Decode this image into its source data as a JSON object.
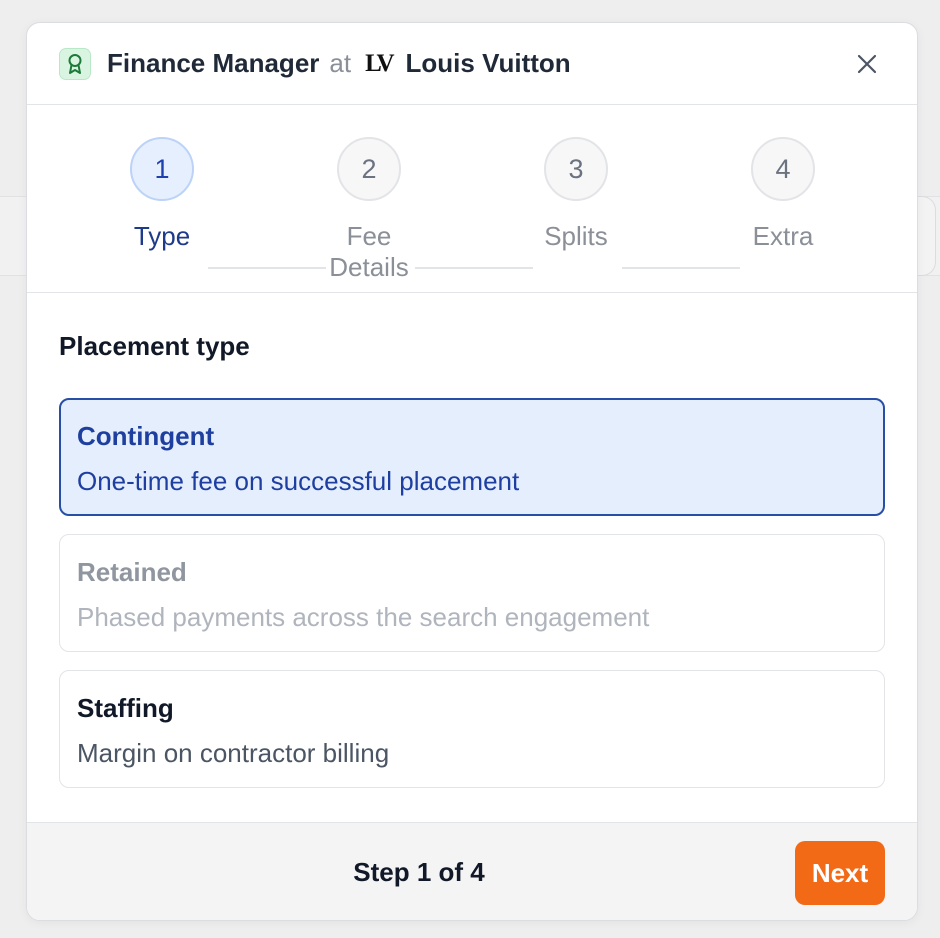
{
  "header": {
    "job_title": "Finance Manager",
    "at": "at",
    "logo_text": "LV",
    "company": "Louis Vuitton"
  },
  "stepper": {
    "steps": [
      {
        "number": "1",
        "label": "Type",
        "active": true
      },
      {
        "number": "2",
        "label": "Fee Details",
        "active": false
      },
      {
        "number": "3",
        "label": "Splits",
        "active": false
      },
      {
        "number": "4",
        "label": "Extra",
        "active": false
      }
    ]
  },
  "placement": {
    "title": "Placement type",
    "options": [
      {
        "title": "Contingent",
        "description": "One-time fee on successful placement",
        "state": "selected"
      },
      {
        "title": "Retained",
        "description": "Phased payments across the search engagement",
        "state": "disabled"
      },
      {
        "title": "Staffing",
        "description": "Margin on contractor billing",
        "state": "normal"
      }
    ]
  },
  "footer": {
    "step_count": "Step 1 of 4",
    "next_label": "Next"
  },
  "colors": {
    "accent": "#f26a16",
    "active_step": "#1e40af",
    "selected_bg": "#e4eefd",
    "icon_green": "#1e7a3a"
  }
}
